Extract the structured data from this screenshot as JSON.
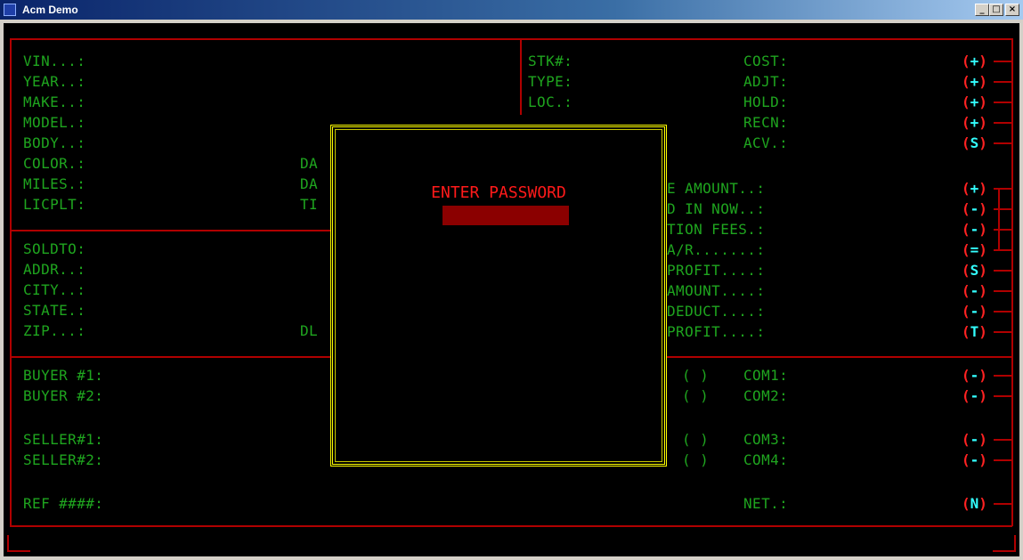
{
  "window": {
    "title": "Acm Demo",
    "min_label": "_",
    "max_label": "□",
    "close_label": "×"
  },
  "vehicle": {
    "vin": "VIN...:",
    "year": "YEAR..:",
    "make": "MAKE..:",
    "model": "MODEL.:",
    "body": "BODY..:",
    "color": "COLOR.:",
    "miles": "MILES.:",
    "licplt": "LICPLT:"
  },
  "partials": {
    "da1": "DA",
    "da2": "DA",
    "ti": "TI",
    "dl": "DL"
  },
  "stock": {
    "stk": "STK#:",
    "type": "TYPE:",
    "loc": "LOC.:"
  },
  "costs": {
    "cost": "COST:",
    "adjt": "ADJT:",
    "hold": "HOLD:",
    "recn": "RECN:",
    "acv": "ACV.:"
  },
  "deal": {
    "amount": "E AMOUNT..:",
    "in_now": "D IN NOW..:",
    "fees": "TION FEES.:",
    "ar": "A/R.......:",
    "profit1": "PROFIT....:",
    "amount2": "AMOUNT....:",
    "deduct": "DEDUCT....:",
    "profit2": "PROFIT....:"
  },
  "customer": {
    "soldto": "SOLDTO:",
    "addr": "ADDR..:",
    "city": "CITY..:",
    "state": "STATE.:",
    "zip": "ZIP...:"
  },
  "people": {
    "buyer1": "BUYER #1:",
    "buyer2": "BUYER #2:",
    "seller1": "SELLER#1:",
    "seller2": "SELLER#2:",
    "ref": "REF ####:"
  },
  "checks": {
    "c1": "( )",
    "c2": "( )",
    "c3": "( )",
    "c4": "( )"
  },
  "commissions": {
    "com1": "COM1:",
    "com2": "COM2:",
    "com3": "COM3:",
    "com4": "COM4:",
    "net": "NET.:"
  },
  "ops": [
    {
      "name": "op-cost",
      "sym": "+"
    },
    {
      "name": "op-adjt",
      "sym": "+"
    },
    {
      "name": "op-hold",
      "sym": "+"
    },
    {
      "name": "op-recn",
      "sym": "+"
    },
    {
      "name": "op-acv",
      "sym": "S"
    },
    {
      "name": "op-amount",
      "sym": "+"
    },
    {
      "name": "op-in-now",
      "sym": "-"
    },
    {
      "name": "op-fees",
      "sym": "-"
    },
    {
      "name": "op-ar",
      "sym": "="
    },
    {
      "name": "op-profit1",
      "sym": "S"
    },
    {
      "name": "op-amount2",
      "sym": "-"
    },
    {
      "name": "op-deduct",
      "sym": "-"
    },
    {
      "name": "op-profit2",
      "sym": "T"
    },
    {
      "name": "op-com1",
      "sym": "-"
    },
    {
      "name": "op-com2",
      "sym": "-"
    },
    {
      "name": "op-com3",
      "sym": "-"
    },
    {
      "name": "op-com4",
      "sym": "-"
    },
    {
      "name": "op-net",
      "sym": "N"
    }
  ],
  "paren_open": "(",
  "paren_close": ")",
  "dialog": {
    "title": "ENTER PASSWORD",
    "value": "",
    "placeholder": ""
  },
  "colors": {
    "label": "#1fa51f",
    "border": "#b00000",
    "dialog_border": "#ffff00",
    "prompt": "#ff1a1a",
    "op_symbol": "#33ffff"
  }
}
